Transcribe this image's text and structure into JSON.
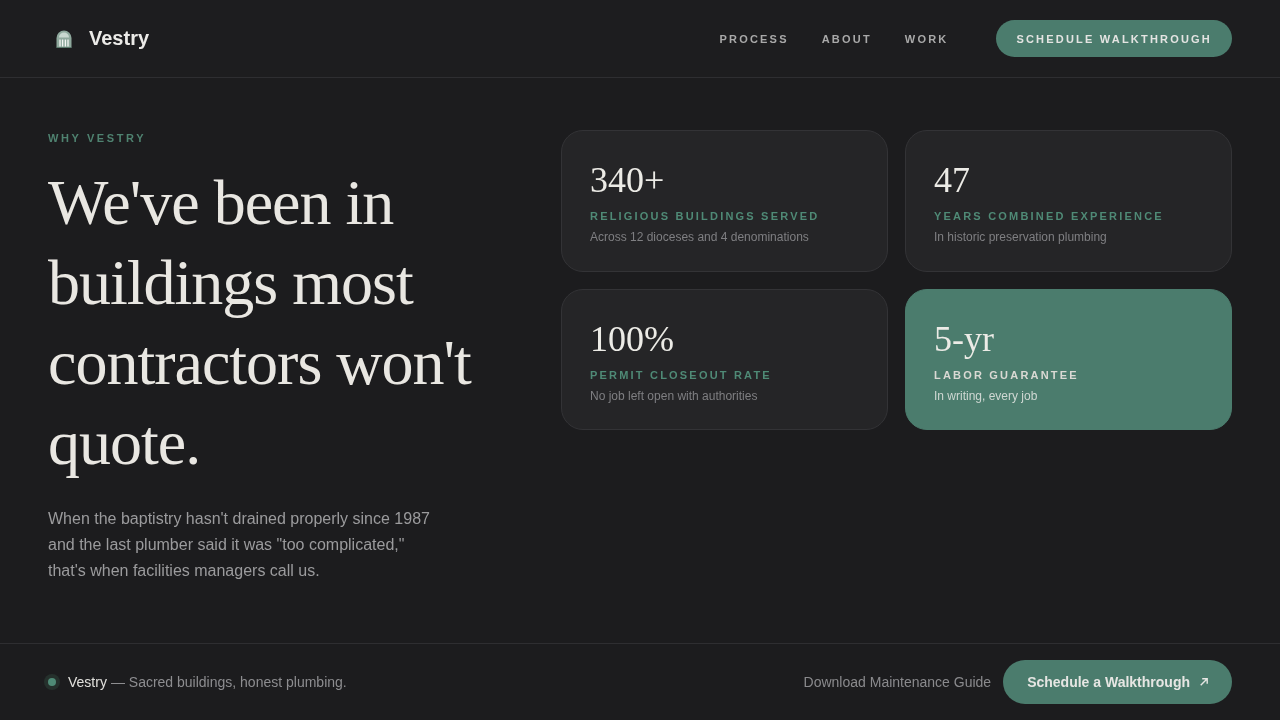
{
  "header": {
    "brand": "Vestry",
    "nav": [
      "PROCESS",
      "ABOUT",
      "WORK"
    ],
    "cta": "SCHEDULE WALKTHROUGH"
  },
  "hero": {
    "eyebrow": "WHY VESTRY",
    "heading": "We've been in buildings most contractors won't quote.",
    "body": "When the baptistry hasn't drained properly since 1987 and the last plumber said it was \"too complicated,\" that's when facilities managers call us."
  },
  "stats": [
    {
      "value": "340+",
      "label": "RELIGIOUS BUILDINGS SERVED",
      "detail": "Across 12 dioceses and 4 denominations",
      "featured": false
    },
    {
      "value": "47",
      "label": "YEARS COMBINED EXPERIENCE",
      "detail": "In historic preservation plumbing",
      "featured": false
    },
    {
      "value": "100%",
      "label": "PERMIT CLOSEOUT RATE",
      "detail": "No job left open with authorities",
      "featured": false
    },
    {
      "value": "5-yr",
      "label": "LABOR GUARANTEE",
      "detail": "In writing, every job",
      "featured": true
    }
  ],
  "footer": {
    "brand": "Vestry",
    "tagline": "— Sacred buildings, honest plumbing.",
    "link": "Download Maintenance Guide",
    "cta": "Schedule a Walkthrough"
  }
}
